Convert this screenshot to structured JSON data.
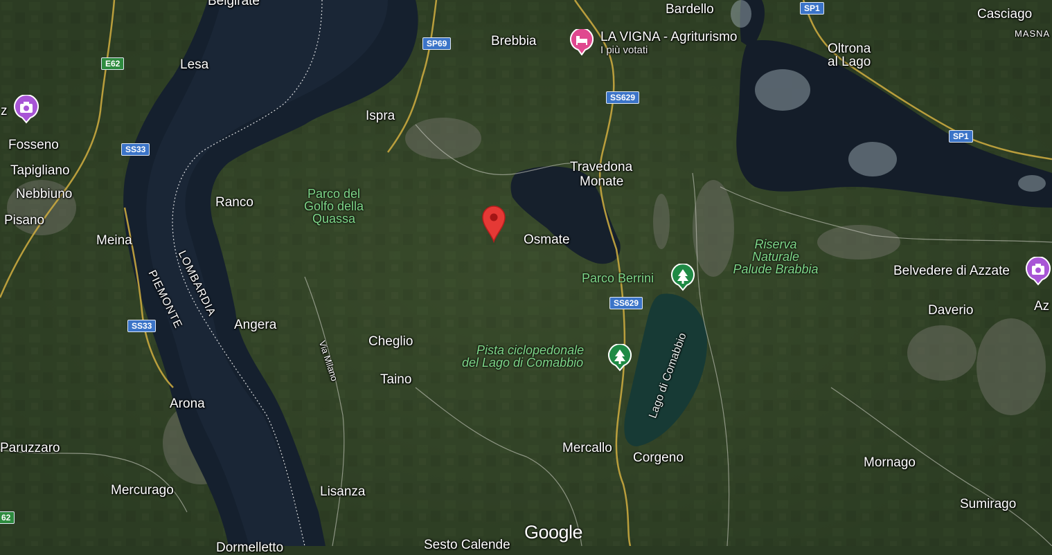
{
  "map": {
    "type": "satellite",
    "provider_logo": "Google",
    "selected_pin_color": "#e53935"
  },
  "places": {
    "brebbia": "Brebbia",
    "bardello": "Bardello",
    "casciago": "Casciago",
    "masna": "MASNA",
    "oltrona": "Oltrona",
    "al_lago": "al Lago",
    "lesa": "Lesa",
    "ispra": "Ispra",
    "fosseno": "Fosseno",
    "tapigliano": "Tapigliano",
    "nebbiuno": "Nebbiuno",
    "pisano": "Pisano",
    "ranco": "Ranco",
    "meina": "Meina",
    "travedona": "Travedona",
    "monate": "Monate",
    "osmate": "Osmate",
    "angera": "Angera",
    "cheglio": "Cheglio",
    "taino": "Taino",
    "arona": "Arona",
    "paruzzaro": "Paruzzaro",
    "mercurago": "Mercurago",
    "lisanza": "Lisanza",
    "mercallo": "Mercallo",
    "corgeno": "Corgeno",
    "mornago": "Mornago",
    "sumirago": "Sumirago",
    "daverio": "Daverio",
    "belgirate_partial": "Belgirate",
    "sesto_calende_partial": "Sesto Calende",
    "az_partial": "Az",
    "z_partial": "z",
    "dormelletto_partial": "Dormelletto"
  },
  "regions": {
    "lombardia": "LOMBARDIA",
    "piemonte": "PIEMONTE"
  },
  "parks": {
    "golfo_line1": "Parco del",
    "golfo_line2": "Golfo della",
    "golfo_line3": "Quassa",
    "berrini": "Parco Berrini",
    "pista_line1": "Pista ciclopedonale",
    "pista_line2": "del Lago di Comabbio",
    "riserva_line1": "Riserva",
    "riserva_line2": "Naturale",
    "riserva_line3": "Palude Brabbia"
  },
  "water": {
    "lago_comabbio": "Lago di Comabbio"
  },
  "roads": {
    "e62": "E62",
    "e62_partial": "62",
    "sp69": "SP69",
    "sp1_top": "SP1",
    "sp1_right": "SP1",
    "ss629_top": "SS629",
    "ss629_mid": "SS629",
    "ss33_top": "SS33",
    "ss33_bottom": "SS33",
    "via_milano": "Via Milano"
  },
  "pois": {
    "la_vigna_name": "LA VIGNA - Agriturismo",
    "la_vigna_sub": "I più votati",
    "belvedere": "Belvedere di Azzate"
  },
  "icons": {
    "hotel": "bed-icon",
    "camera": "camera-icon",
    "park": "tree-icon",
    "pin": "map-pin-icon"
  }
}
